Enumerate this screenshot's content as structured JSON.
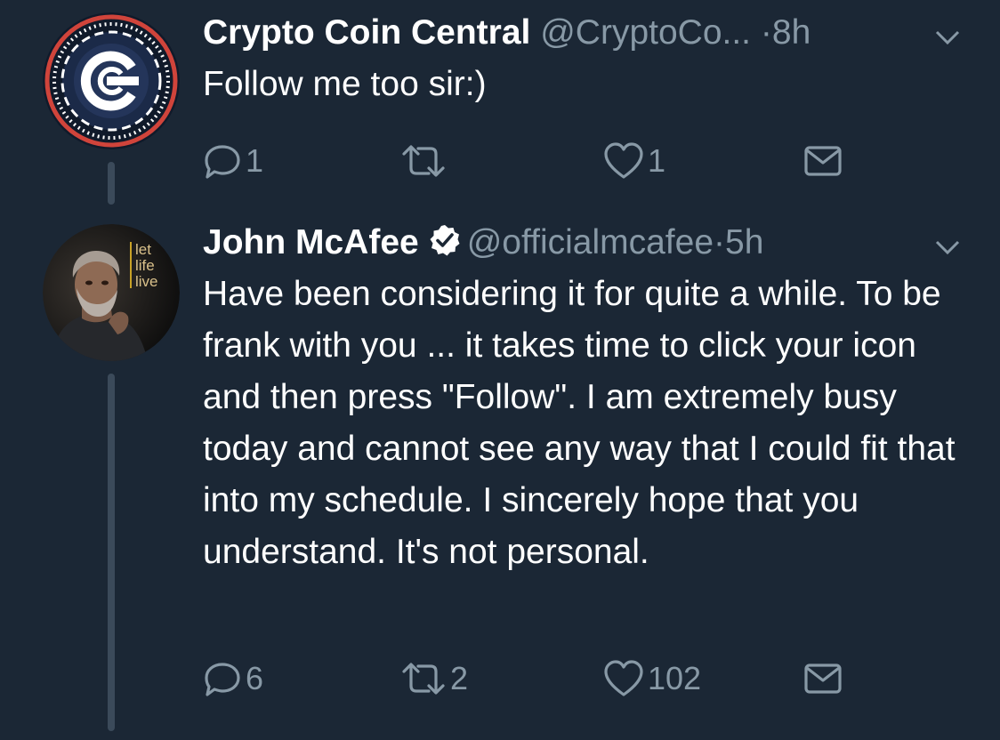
{
  "tweet1": {
    "display_name": "Crypto Coin Central",
    "handle": "@CryptoCo...",
    "separator": "·",
    "time": "8h",
    "text": "Follow me too sir:)",
    "reply_count": "1",
    "retweet_count": "",
    "like_count": "1",
    "avatar_icon": "crypto-coin-logo"
  },
  "tweet2": {
    "display_name": "John McAfee",
    "verified": true,
    "handle": "@officialmcafee",
    "separator": "·",
    "time": "5h",
    "text": "Have been considering it for quite a while. To be frank with you ... it takes time to click your icon and then press \"Follow\". I am extremely busy today and cannot see any way that I could fit that into my schedule. I sincerely hope that you understand. It's not personal.",
    "reply_count": "6",
    "retweet_count": "2",
    "like_count": "102",
    "avatar_text": [
      "let",
      "life",
      "live"
    ]
  },
  "colors": {
    "background": "#1b2735",
    "text": "#ffffff",
    "muted": "#8899a6",
    "thread_line": "#3b4a5a",
    "verified": "#ffffff",
    "coin_logo_ring": "#d0443b"
  }
}
